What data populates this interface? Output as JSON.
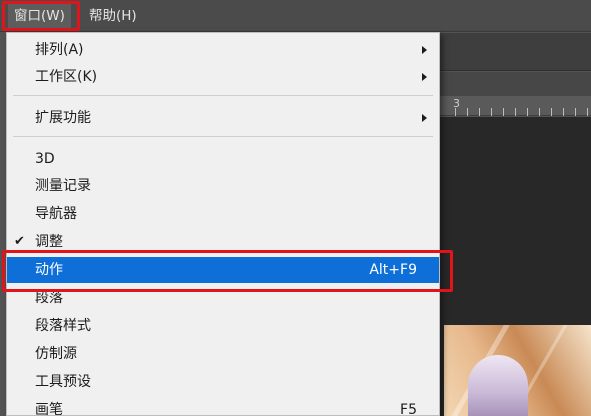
{
  "menubar": {
    "items": [
      {
        "label": "窗口(W)",
        "active": true,
        "highlighted": true
      },
      {
        "label": "帮助(H)",
        "active": false
      }
    ]
  },
  "ruler": {
    "number": "3"
  },
  "dropdown": {
    "items": [
      {
        "label": "排列(A)",
        "submenu": true
      },
      {
        "label": "工作区(K)",
        "submenu": true
      },
      {
        "label": "扩展功能",
        "submenu": true
      },
      {
        "label": "3D"
      },
      {
        "label": "测量记录"
      },
      {
        "label": "导航器"
      },
      {
        "label": "调整",
        "checked": true
      },
      {
        "label": "动作",
        "shortcut": "Alt+F9",
        "selected": true,
        "highlighted": true
      },
      {
        "label": "段落"
      },
      {
        "label": "段落样式"
      },
      {
        "label": "仿制源"
      },
      {
        "label": "工具预设"
      },
      {
        "label": "画笔",
        "shortcut": "F5"
      }
    ]
  },
  "colors": {
    "selection": "#0f6fd8",
    "highlight_box": "#e1141b",
    "menu_background": "#f0f0f0",
    "app_background": "#535353"
  },
  "icons": {
    "check": "✔"
  }
}
